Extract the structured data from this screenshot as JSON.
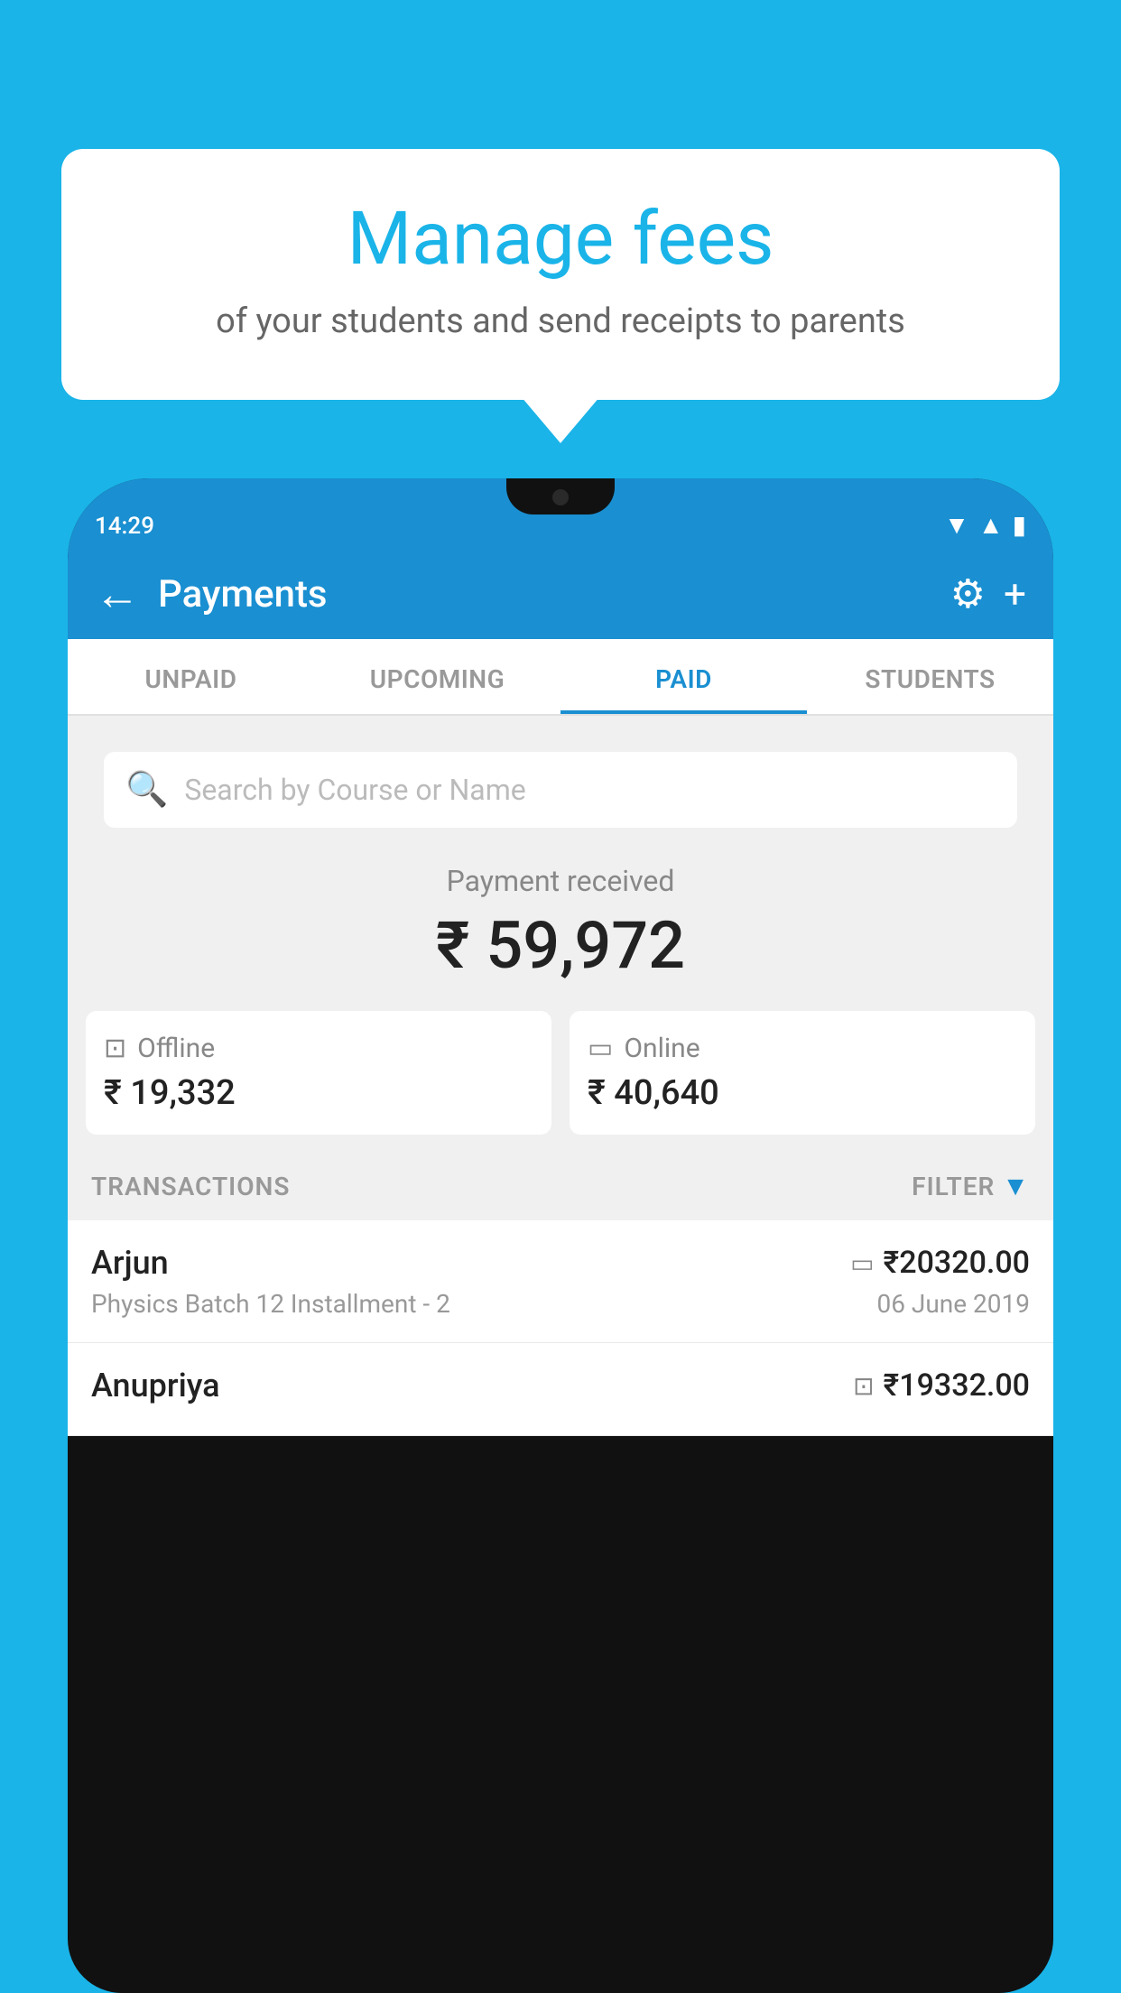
{
  "background_color": "#1ab4e8",
  "bubble": {
    "title": "Manage fees",
    "subtitle": "of your students and send receipts to parents"
  },
  "status_bar": {
    "time": "14:29",
    "icons": [
      "wifi",
      "signal",
      "battery"
    ]
  },
  "app_bar": {
    "title": "Payments",
    "back_label": "←",
    "gear_label": "⚙",
    "plus_label": "+"
  },
  "tabs": [
    {
      "label": "UNPAID",
      "active": false
    },
    {
      "label": "UPCOMING",
      "active": false
    },
    {
      "label": "PAID",
      "active": true
    },
    {
      "label": "STUDENTS",
      "active": false
    }
  ],
  "search": {
    "placeholder": "Search by Course or Name"
  },
  "payment_section": {
    "label": "Payment received",
    "total_amount": "₹ 59,972",
    "offline_label": "Offline",
    "offline_amount": "₹ 19,332",
    "online_label": "Online",
    "online_amount": "₹ 40,640"
  },
  "transactions": {
    "header_label": "TRANSACTIONS",
    "filter_label": "FILTER",
    "items": [
      {
        "name": "Arjun",
        "amount": "₹20320.00",
        "course": "Physics Batch 12 Installment - 2",
        "date": "06 June 2019",
        "payment_type": "card"
      },
      {
        "name": "Anupriya",
        "amount": "₹19332.00",
        "course": "",
        "date": "",
        "payment_type": "cash"
      }
    ]
  }
}
